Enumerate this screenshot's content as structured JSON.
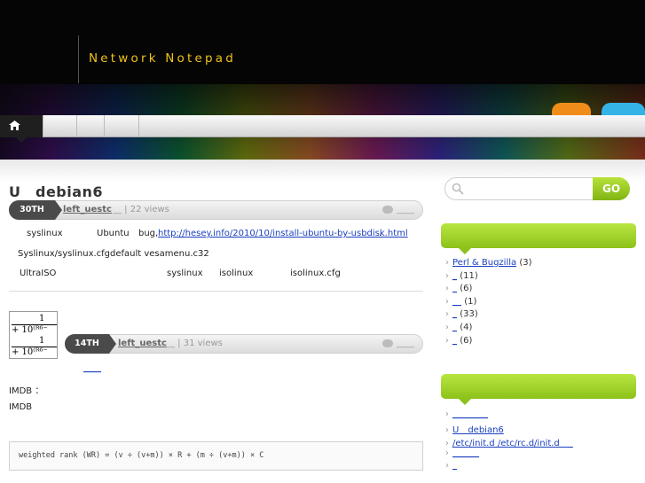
{
  "site": {
    "title": "Network Notepad"
  },
  "nav": {
    "home_icon": "home-icon"
  },
  "post1": {
    "title": "U　debian6",
    "date": "30TH",
    "author": "left_uestc",
    "views": "__ | 22 views",
    "comments": "____",
    "lines": [
      {
        "a": "syslinux",
        "b": "Ubuntu",
        "c": "bug,",
        "link": "http://hesey.info/2010/10/install-ubuntu-by-usbdisk.html",
        "d": "."
      },
      {
        "a": "Syslinux/syslinux.cfg",
        "b": "default vesamenu.c32"
      },
      {
        "a": "UltraISO",
        "b": "syslinux",
        "c": "isolinux",
        "d": "isolinux.cfg"
      }
    ]
  },
  "post2": {
    "date": "14TH",
    "author": "left_uestc",
    "views": "__ | 31 views",
    "comments": "____",
    "link_under": "____",
    "line_imdb1": "IMDB ：",
    "line_imdb2": "IMDB",
    "code": "weighted rank (WR) = (v ÷ (v+m)) × R + (m ÷ (v+m)) × C",
    "formula": {
      "num1": "1",
      "den1": "+ 10⁽ᴿ⁶⁻",
      "num2": "1",
      "den2": "+ 10⁽ᴿ⁶⁻"
    }
  },
  "sidebar": {
    "search_placeholder": "",
    "go_label": "GO",
    "categories": [
      {
        "label": "Perl & Bugzilla",
        "count": "(3)"
      },
      {
        "label": "_",
        "count": "(11)"
      },
      {
        "label": "_",
        "count": "(6)"
      },
      {
        "label": "__",
        "count": "(1)"
      },
      {
        "label": "_",
        "count": "(33)"
      },
      {
        "label": "_",
        "count": "(4)"
      },
      {
        "label": "_",
        "count": "(6)"
      }
    ],
    "recent": [
      {
        "label": "________"
      },
      {
        "label": "U　debian6"
      },
      {
        "label": "/etc/init.d /etc/rc.d/init.d　_"
      },
      {
        "label": "______"
      },
      {
        "label": "_"
      }
    ]
  },
  "colors": {
    "accent_green": "#8cc21a",
    "title_gold": "#f0c21a",
    "link_blue": "#1a3fbf"
  }
}
